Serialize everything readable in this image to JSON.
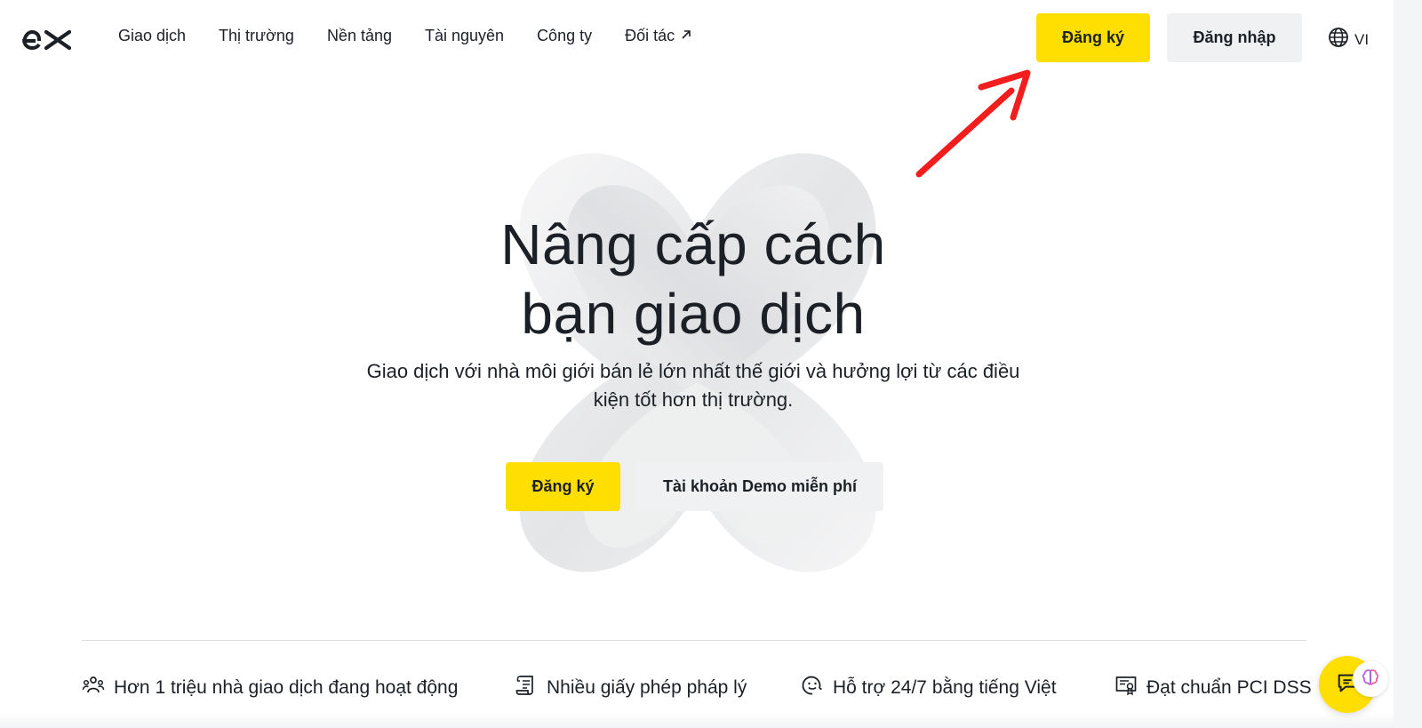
{
  "brand": {
    "logo_text": "ex",
    "accent_color": "#ffde02"
  },
  "nav": {
    "items": [
      {
        "label": "Giao dịch"
      },
      {
        "label": "Thị trường"
      },
      {
        "label": "Nền tảng"
      },
      {
        "label": "Tài nguyên"
      },
      {
        "label": "Công ty"
      },
      {
        "label": "Đối tác",
        "icon": "arrow-up-right-icon"
      }
    ]
  },
  "header": {
    "register_label": "Đăng ký",
    "login_label": "Đăng nhập",
    "language": "VI",
    "language_icon": "globe-icon"
  },
  "hero": {
    "title_line1": "Nâng cấp cách",
    "title_line2": "bạn giao dịch",
    "subtitle_line1": "Giao dịch với nhà môi giới bán lẻ lớn nhất thế giới và hưởng lợi từ các điều",
    "subtitle_line2": "kiện tốt hơn thị trường.",
    "register_label": "Đăng ký",
    "demo_label": "Tài khoản Demo miễn phí"
  },
  "features": [
    {
      "icon": "users-icon",
      "label": "Hơn 1 triệu nhà giao dịch đang hoạt động"
    },
    {
      "icon": "scroll-license-icon",
      "label": "Nhiều giấy phép pháp lý"
    },
    {
      "icon": "smiley-support-icon",
      "label": "Hỗ trợ 24/7 bằng tiếng Việt"
    },
    {
      "icon": "certificate-icon",
      "label": "Đạt chuẩn PCI DSS"
    }
  ],
  "chat": {
    "icon": "chat-icon",
    "ai_icon": "brain-icon"
  }
}
